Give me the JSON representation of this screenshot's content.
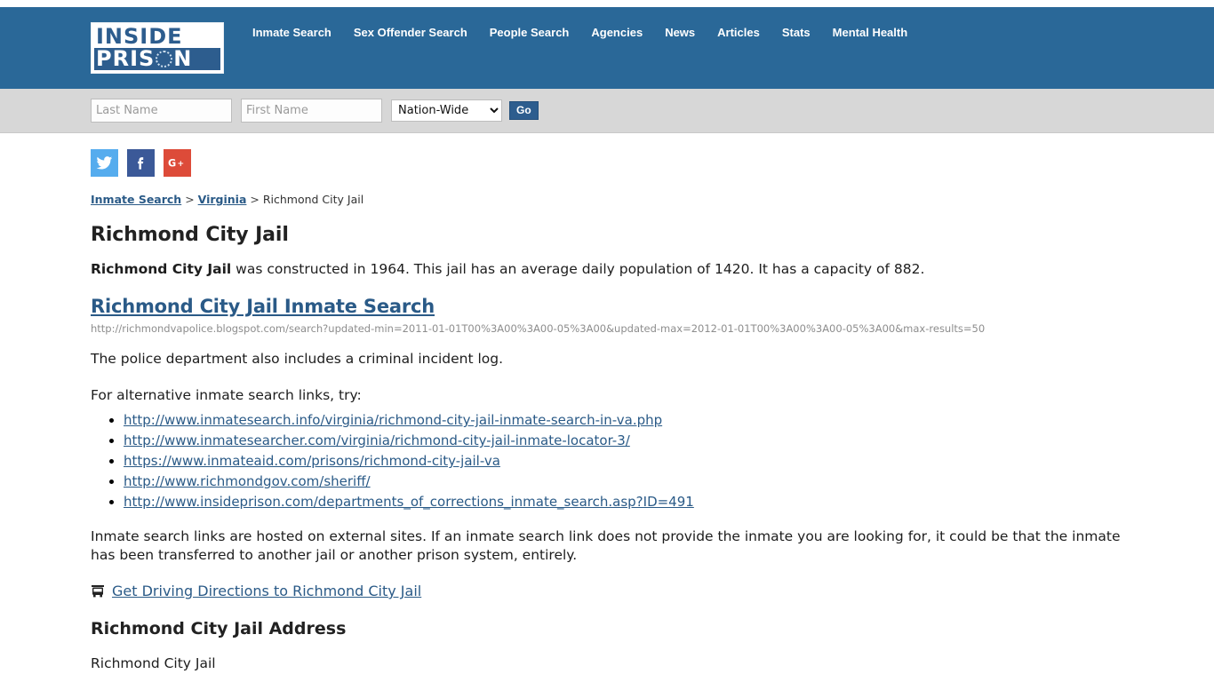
{
  "header": {
    "logo": {
      "line1": "INSIDE",
      "line2_before": "PRIS",
      "line2_after": "N",
      "icon": "barbed-wire-circle"
    },
    "nav": [
      {
        "label": "Inmate Search"
      },
      {
        "label": "Sex Offender Search"
      },
      {
        "label": "People Search"
      },
      {
        "label": "Agencies"
      },
      {
        "label": "News"
      },
      {
        "label": "Articles"
      },
      {
        "label": "Stats"
      },
      {
        "label": "Mental Health"
      }
    ]
  },
  "search": {
    "last_name_placeholder": "Last Name",
    "last_name_value": "",
    "first_name_placeholder": "First Name",
    "first_name_value": "",
    "scope_selected": "Nation-Wide",
    "scope_options": [
      "Nation-Wide"
    ],
    "go_label": "Go"
  },
  "social": [
    {
      "name": "twitter",
      "label": "Twitter"
    },
    {
      "name": "facebook",
      "label": "Facebook"
    },
    {
      "name": "googleplus",
      "label": "Google Plus"
    }
  ],
  "breadcrumb": {
    "item1": "Inmate Search",
    "sep1": " > ",
    "item2": "Virginia",
    "sep2": " > ",
    "current": "Richmond City Jail"
  },
  "main": {
    "page_title": "Richmond City Jail",
    "intro_bold": "Richmond City Jail",
    "intro_rest": " was constructed in 1964. This jail has an average daily population of 1420. It has a capacity of 882.",
    "inmate_search_heading": "Richmond City Jail Inmate Search",
    "raw_url": "http://richmondvapolice.blogspot.com/search?updated-min=2011-01-01T00%3A00%3A00-05%3A00&updated-max=2012-01-01T00%3A00%3A00-05%3A00&max-results=50",
    "incident_log_text": "The police department also includes a criminal incident log.",
    "alternative_intro": "For alternative inmate search links, try:",
    "alternative_links": [
      "http://www.inmatesearch.info/virginia/richmond-city-jail-inmate-search-in-va.php",
      "http://www.inmatesearcher.com/virginia/richmond-city-jail-inmate-locator-3/",
      "https://www.inmateaid.com/prisons/richmond-city-jail-va",
      "http://www.richmondgov.com/sheriff/",
      "http://www.insideprison.com/departments_of_corrections_inmate_search.asp?ID=491"
    ],
    "disclaimer": "Inmate search links are hosted on external sites. If an inmate search link does not provide the inmate you are looking for, it could be that the inmate has been transferred to another jail or another prison system, entirely.",
    "directions_link": "Get Driving Directions to Richmond City Jail",
    "directions_icon": "bus-icon",
    "address_heading": "Richmond City Jail Address",
    "address_line1": "Richmond City Jail"
  },
  "colors": {
    "header_blue": "#2a6898",
    "logo_blue": "#2d5d8e",
    "link_blue": "#2a5a87",
    "search_bar_gray": "#d7d7d7",
    "twitter": "#55acee",
    "facebook": "#3b5998",
    "googleplus": "#dd4b39"
  }
}
